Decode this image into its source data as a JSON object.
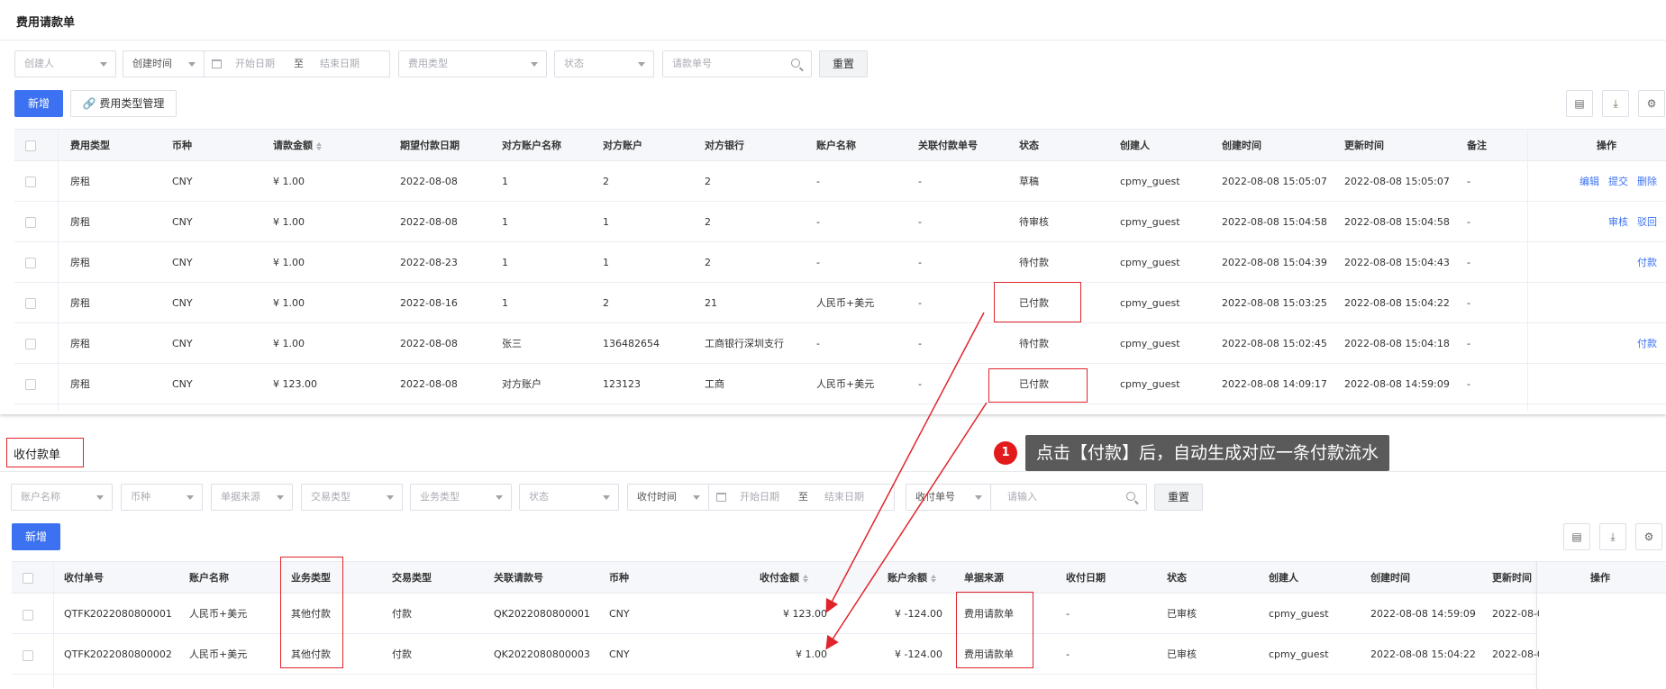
{
  "top": {
    "title": "费用请款单",
    "filters": {
      "creator": "创建人",
      "create_time": "创建时间",
      "start_date": "开始日期",
      "to": "至",
      "end_date": "结束日期",
      "fee_type": "费用类型",
      "status": "状态",
      "request_no": "请款单号"
    },
    "reset": "重置",
    "new": "新增",
    "fee_type_manage": "费用类型管理",
    "columns": [
      "费用类型",
      "币种",
      "请款金额",
      "期望付款日期",
      "对方账户名称",
      "对方账户",
      "对方银行",
      "账户名称",
      "关联付款单号",
      "状态",
      "创建人",
      "创建时间",
      "更新时间",
      "备注",
      "操作"
    ],
    "rows": [
      {
        "cells": [
          "房租",
          "CNY",
          "¥ 1.00",
          "2022-08-08",
          "1",
          "2",
          "2",
          "-",
          "-",
          "草稿",
          "cpmy_guest",
          "2022-08-08 15:05:07",
          "2022-08-08 15:05:07",
          "-"
        ],
        "actions": [
          "编辑",
          "提交",
          "删除"
        ]
      },
      {
        "cells": [
          "房租",
          "CNY",
          "¥ 1.00",
          "2022-08-08",
          "1",
          "1",
          "2",
          "-",
          "-",
          "待审核",
          "cpmy_guest",
          "2022-08-08 15:04:58",
          "2022-08-08 15:04:58",
          "-"
        ],
        "actions": [
          "审核",
          "驳回"
        ]
      },
      {
        "cells": [
          "房租",
          "CNY",
          "¥ 1.00",
          "2022-08-23",
          "1",
          "1",
          "2",
          "-",
          "-",
          "待付款",
          "cpmy_guest",
          "2022-08-08 15:04:39",
          "2022-08-08 15:04:43",
          "-"
        ],
        "actions": [
          "付款"
        ]
      },
      {
        "cells": [
          "房租",
          "CNY",
          "¥ 1.00",
          "2022-08-16",
          "1",
          "2",
          "21",
          "人民币+美元",
          "-",
          "已付款",
          "cpmy_guest",
          "2022-08-08 15:03:25",
          "2022-08-08 15:04:22",
          "-"
        ],
        "actions": []
      },
      {
        "cells": [
          "房租",
          "CNY",
          "¥ 1.00",
          "2022-08-08",
          "张三",
          "136482654",
          "工商银行深圳支行",
          "-",
          "-",
          "待付款",
          "cpmy_guest",
          "2022-08-08 15:02:45",
          "2022-08-08 15:04:18",
          "-"
        ],
        "actions": [
          "付款"
        ]
      },
      {
        "cells": [
          "房租",
          "CNY",
          "¥ 123.00",
          "2022-08-08",
          "对方账户",
          "123123",
          "工商",
          "人民币+美元",
          "-",
          "已付款",
          "cpmy_guest",
          "2022-08-08 14:09:17",
          "2022-08-08 14:59:09",
          "-"
        ],
        "actions": []
      }
    ]
  },
  "bottom": {
    "title": "收付款单",
    "filters": {
      "account_name": "账户名称",
      "currency": "币种",
      "doc_source": "单据来源",
      "trade_type": "交易类型",
      "biz_type": "业务类型",
      "status": "状态",
      "pay_time": "收付时间",
      "start_date": "开始日期",
      "to": "至",
      "end_date": "结束日期",
      "pay_no": "收付单号",
      "input_placeholder": "请输入"
    },
    "reset": "重置",
    "new": "新增",
    "columns": [
      "收付单号",
      "账户名称",
      "业务类型",
      "交易类型",
      "关联请款号",
      "币种",
      "收付金额",
      "账户余额",
      "单据来源",
      "收付日期",
      "状态",
      "创建人",
      "创建时间",
      "更新时间",
      "操作"
    ],
    "rows": [
      {
        "cells": [
          "QTFK2022080800001",
          "人民币+美元",
          "其他付款",
          "付款",
          "QK2022080800001",
          "CNY",
          "¥ 123.00",
          "¥ -124.00",
          "费用请款单",
          "-",
          "已审核",
          "cpmy_guest",
          "2022-08-08 14:59:09",
          "2022-08-0"
        ]
      },
      {
        "cells": [
          "QTFK2022080800002",
          "人民币+美元",
          "其他付款",
          "付款",
          "QK2022080800003",
          "CNY",
          "¥ 1.00",
          "¥ -124.00",
          "费用请款单",
          "-",
          "已审核",
          "cpmy_guest",
          "2022-08-08 15:04:22",
          "2022-08-0"
        ]
      }
    ]
  },
  "annotation": {
    "badge": "1",
    "text": "点击【付款】后，自动生成对应一条付款流水",
    "color": "#e1242b"
  }
}
